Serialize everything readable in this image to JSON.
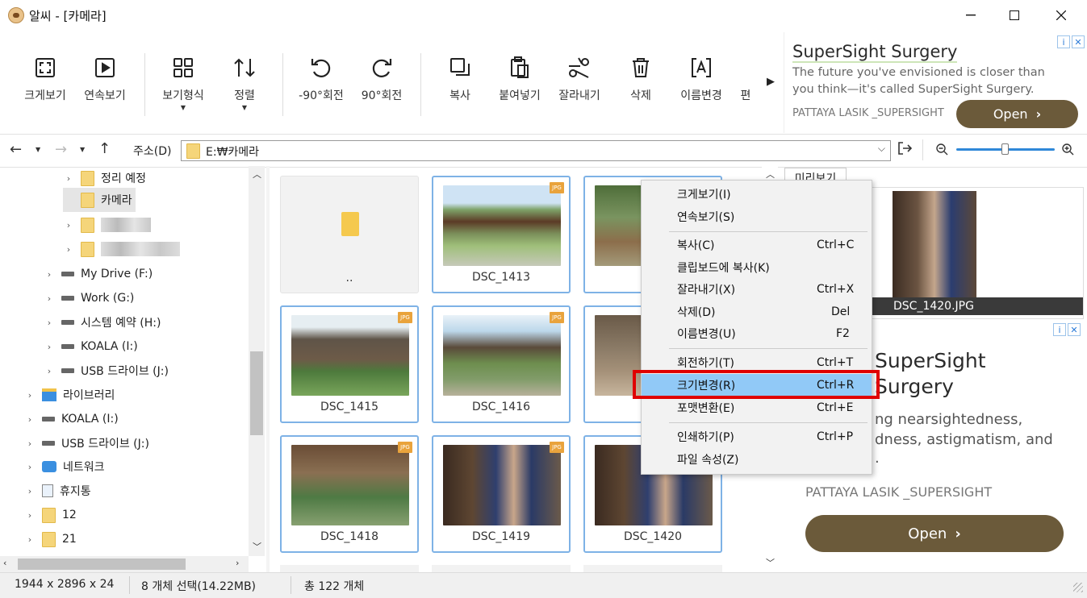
{
  "window": {
    "title": "알씨 - [카메라]"
  },
  "toolbar": [
    {
      "label": "크게보기",
      "icon": "fullscreen-icon"
    },
    {
      "label": "연속보기",
      "icon": "play-icon"
    },
    {
      "label": "보기형식",
      "icon": "grid-icon"
    },
    {
      "label": "정렬",
      "icon": "sort-icon"
    },
    {
      "label": "-90°회전",
      "icon": "rotate-left-icon"
    },
    {
      "label": "90°회전",
      "icon": "rotate-right-icon"
    },
    {
      "label": "복사",
      "icon": "copy-icon"
    },
    {
      "label": "붙여넣기",
      "icon": "paste-icon"
    },
    {
      "label": "잘라내기",
      "icon": "scissors-icon"
    },
    {
      "label": "삭제",
      "icon": "trash-icon"
    },
    {
      "label": "이름변경",
      "icon": "rename-icon"
    },
    {
      "label": "편",
      "icon": "edit-icon"
    }
  ],
  "ad_top": {
    "title": "SuperSight Surgery",
    "body": "The future you've envisioned is closer than you think—it's called SuperSight Surgery.",
    "advertiser": "PATTAYA LASIK _SUPERSIGHT",
    "button": "Open"
  },
  "address": {
    "label": "주소(D)",
    "path": "E:₩카메라"
  },
  "tree": [
    {
      "label": "정리 예정",
      "type": "folder",
      "expand": true
    },
    {
      "label": "카메라",
      "type": "folder",
      "expand": false,
      "selected": true
    },
    {
      "label": "",
      "type": "folder",
      "expand": true,
      "blurred": true
    },
    {
      "label": "",
      "type": "folder",
      "expand": true,
      "blurred": true
    },
    {
      "label": "My Drive (F:)",
      "type": "drive",
      "expand": true
    },
    {
      "label": "Work (G:)",
      "type": "drive",
      "expand": true
    },
    {
      "label": "시스템 예약 (H:)",
      "type": "drive",
      "expand": true
    },
    {
      "label": "KOALA (I:)",
      "type": "drive",
      "expand": true
    },
    {
      "label": "USB 드라이브 (J:)",
      "type": "drive",
      "expand": true
    },
    {
      "label": "라이브러리",
      "type": "library",
      "expand": true
    },
    {
      "label": "KOALA (I:)",
      "type": "drive",
      "expand": true
    },
    {
      "label": "USB 드라이브 (J:)",
      "type": "drive",
      "expand": true
    },
    {
      "label": "네트워크",
      "type": "network",
      "expand": true
    },
    {
      "label": "휴지통",
      "type": "recycle",
      "expand": true
    },
    {
      "label": "12",
      "type": "folder",
      "expand": true
    },
    {
      "label": "21",
      "type": "folder",
      "expand": true
    }
  ],
  "files": [
    {
      "name": "..",
      "type": "folder"
    },
    {
      "name": "DSC_1413",
      "type": "jpg",
      "selected": true
    },
    {
      "name": "DS",
      "type": "jpg",
      "selected": true
    },
    {
      "name": "DSC_1415",
      "type": "jpg",
      "selected": true
    },
    {
      "name": "DSC_1416",
      "type": "jpg",
      "selected": true
    },
    {
      "name": "DS",
      "type": "jpg",
      "selected": true
    },
    {
      "name": "DSC_1418",
      "type": "jpg",
      "selected": true
    },
    {
      "name": "DSC_1419",
      "type": "jpg",
      "selected": true
    },
    {
      "name": "DSC_1420",
      "type": "jpg",
      "selected": true
    }
  ],
  "context_menu": [
    {
      "label": "크게보기(I)",
      "shortcut": ""
    },
    {
      "label": "연속보기(S)",
      "shortcut": ""
    },
    {
      "label": "복사(C)",
      "shortcut": "Ctrl+C"
    },
    {
      "label": "클립보드에 복사(K)",
      "shortcut": ""
    },
    {
      "label": "잘라내기(X)",
      "shortcut": "Ctrl+X"
    },
    {
      "label": "삭제(D)",
      "shortcut": "Del"
    },
    {
      "label": "이름변경(U)",
      "shortcut": "F2"
    },
    {
      "label": "회전하기(T)",
      "shortcut": "Ctrl+T"
    },
    {
      "label": "크기변경(R)",
      "shortcut": "Ctrl+R",
      "highlighted": true
    },
    {
      "label": "포맷변환(E)",
      "shortcut": "Ctrl+E"
    },
    {
      "label": "인쇄하기(P)",
      "shortcut": "Ctrl+P"
    },
    {
      "label": "파일 속성(Z)",
      "shortcut": ""
    }
  ],
  "preview": {
    "tab": "미리보기",
    "caption": "DSC_1420.JPG"
  },
  "ad_side": {
    "title_line1": "SuperSight",
    "title_line2": "Surgery",
    "body_line1": "ng nearsightedness,",
    "body_line2": "dness, astigmatism, and",
    "body_line3": ".",
    "advertiser": "PATTAYA LASIK _SUPERSIGHT",
    "button": "Open"
  },
  "status": {
    "dims": "1944 x 2896 x 24",
    "selection": "8 개체 선택(14.22MB)",
    "total": "총 122 개체"
  },
  "colors": {
    "accent": "#7eb2e6",
    "menu_highlight": "#91c9f7",
    "red_box": "#e00000",
    "ad_button": "#6b5a3a",
    "ad_title": "#2b2b2b"
  }
}
